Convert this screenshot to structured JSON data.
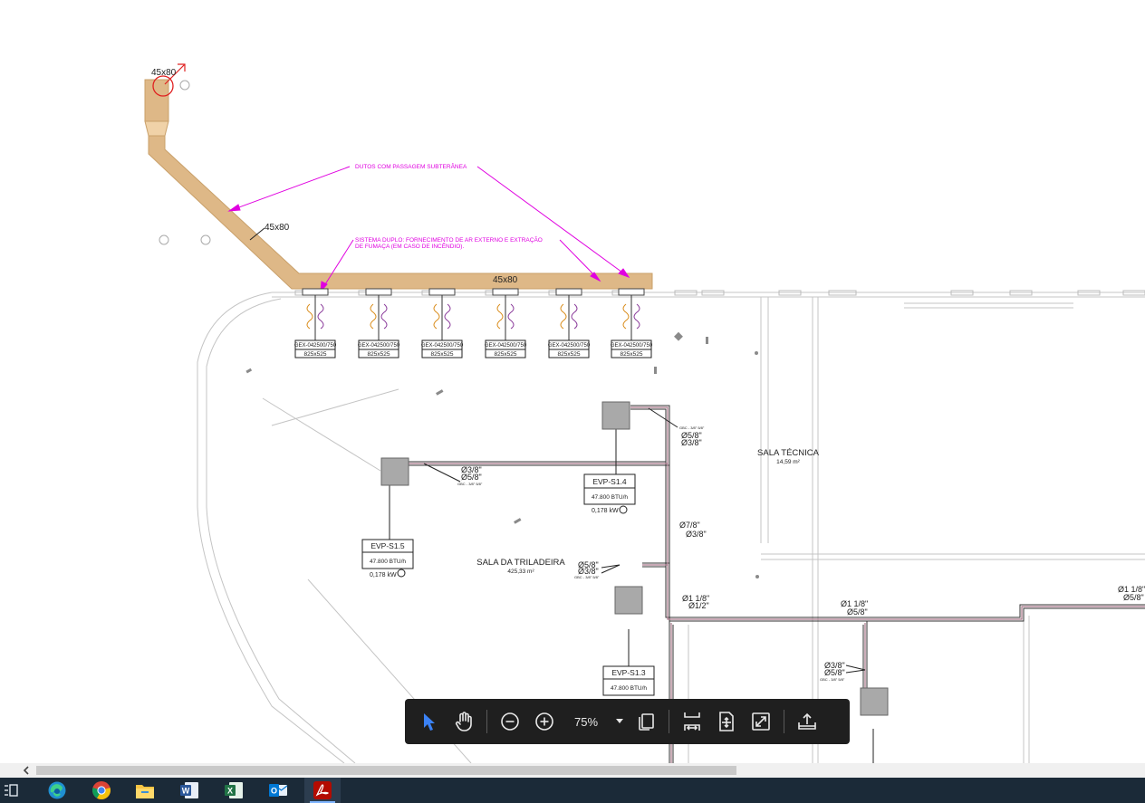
{
  "drawing": {
    "duct_sizes": [
      "45x80",
      "45x80",
      "45x80"
    ],
    "notes": {
      "ducts": "DUTOS COM PASSAGEM SUBTERÂNEA",
      "dual_line1": "SISTEMA DUPLO: FORNECIMENTO DE AR EXTERNO E  EXTRAÇÃO",
      "dual_line2": "DE FUMAÇA (EM CASO DE INCÊNDIO)."
    },
    "grilles": [
      {
        "code": "GEX-042500/750",
        "size": "825x525"
      },
      {
        "code": "GEX-042500/750",
        "size": "825x525"
      },
      {
        "code": "GEX-042500/750",
        "size": "825x525"
      },
      {
        "code": "GEX-042500/750",
        "size": "825x525"
      },
      {
        "code": "GEX-042500/750",
        "size": "825x525"
      },
      {
        "code": "GEX-042500/750",
        "size": "825x525"
      }
    ],
    "units": [
      {
        "name": "EVP-S1.4",
        "capacity": "47.800 BTU/h",
        "power": "0,178 kW"
      },
      {
        "name": "EVP-S1.5",
        "capacity": "47.800 BTU/h",
        "power": "0,178 kW"
      },
      {
        "name": "EVP-S1.3",
        "capacity": "47.800 BTU/h"
      }
    ],
    "rooms": [
      {
        "name": "SALA TÉCNICA",
        "area": "14,59 m²"
      },
      {
        "name": "SALA DA TRILADEIRA",
        "area": "425,33 m²"
      }
    ],
    "pipes": {
      "p58": "Ø5/8\"",
      "p38": "Ø3/8\"",
      "p78": "Ø7/8\"",
      "p118": "Ø1 1/8\"",
      "p12": "Ø1/2\"",
      "gbc": "GBC - 3/8\" 5/8\""
    }
  },
  "toolbar": {
    "zoom": "75%",
    "tools": [
      "select-tool",
      "hand-tool",
      "zoom-out",
      "zoom-in",
      "page-view",
      "fit-width",
      "fit-page",
      "full-screen",
      "share"
    ]
  },
  "taskbar": {
    "apps": [
      "task-view",
      "edge",
      "chrome",
      "file-explorer",
      "word",
      "excel",
      "outlook",
      "acrobat"
    ],
    "active": "acrobat"
  },
  "colors": {
    "duct": "#deb887",
    "duct_edge": "#c9a06a",
    "annotation": "#e000e0",
    "toolbar_bg": "#1f1f1f",
    "taskbar_bg": "#1b2a38",
    "select_blue": "#3b82f6"
  }
}
